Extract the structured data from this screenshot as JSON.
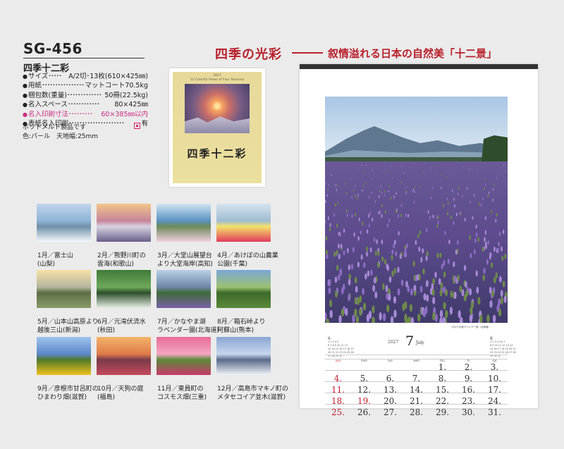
{
  "product": {
    "code": "SG-456",
    "name": "四季十二彩",
    "specs": [
      {
        "key": "サイズ",
        "dots": "･････",
        "value": "A/2切･13枚(610×425㎜)",
        "highlight": false
      },
      {
        "key": "用紙",
        "dots": "････････････････････",
        "value": "マットコート70.5kg",
        "highlight": false
      },
      {
        "key": "梱包数(重量)",
        "dots": "･････････････",
        "value": "50冊(22.5kg)",
        "highlight": false
      },
      {
        "key": "名入スペース",
        "dots": "････････････",
        "value": "80×425㎜",
        "highlight": false
      },
      {
        "key": "名入印刷寸法",
        "dots": "･････････",
        "value": "60×385㎜以内",
        "highlight": true
      },
      {
        "key": "表紙名入印刷",
        "dots": "･････････････････････",
        "value": "有",
        "highlight": false
      }
    ],
    "notes": [
      "ホットメルト製品です",
      "色:パール　天地幅:25mm"
    ]
  },
  "heading": {
    "main": "四季の光彩",
    "sub": "叙情溢れる日本の自然美「十二景」"
  },
  "cover": {
    "title": "四季十二彩",
    "subtitle": "12 Colorful Views of Four Seasons",
    "year_label": "2027"
  },
  "months": [
    {
      "caption1": "1月／富士山",
      "caption2": "(山梨)",
      "palette": [
        "#bfd5ec",
        "#8fb3d6",
        "#f4f7fb",
        "#6f8fa8"
      ]
    },
    {
      "caption1": "2月／熊野川町の",
      "caption2": "雲海(和歌山)",
      "palette": [
        "#f2c58a",
        "#c7849a",
        "#6a5f8a",
        "#d8d3e0"
      ]
    },
    {
      "caption1": "3月／大堂山展望台",
      "caption2": "より大堂海岸(高知)",
      "palette": [
        "#cfe3f2",
        "#5a92c0",
        "#f2cfe0",
        "#6e8a5a"
      ]
    },
    {
      "caption1": "4月／あけぼの山農業",
      "caption2": "公園(千葉)",
      "palette": [
        "#d5e3ee",
        "#9fbcd2",
        "#e23b5b",
        "#f3e26a"
      ]
    },
    {
      "caption1": "5月／山本山高原より",
      "caption2": "越後三山(新潟)",
      "palette": [
        "#f6e1a6",
        "#b4b5a0",
        "#8a9b6a",
        "#5c6e44"
      ]
    },
    {
      "caption1": "6月／元滝伏流水",
      "caption2": "(秋田)",
      "palette": [
        "#3f7a3a",
        "#6ea95a",
        "#e7efe5",
        "#2d4f2a"
      ]
    },
    {
      "caption1": "7月／かなやま湖",
      "caption2": "ラベンダー園(北海道)",
      "palette": [
        "#b9d0e6",
        "#6f86a8",
        "#7b62a8",
        "#3f6b3a"
      ]
    },
    {
      "caption1": "8月／箱石峠より",
      "caption2": "阿蘇山(熊本)",
      "palette": [
        "#7aa6d8",
        "#9cc070",
        "#5a8a3a",
        "#3d6a2a"
      ]
    },
    {
      "caption1": "9月／彦根市甘呂町の",
      "caption2": "ひまわり畑(滋賀)",
      "palette": [
        "#9ec4ee",
        "#5c86c8",
        "#f1c21f",
        "#4f7a2a"
      ]
    },
    {
      "caption1": "10月／天狗の庭",
      "caption2": "(福島)",
      "palette": [
        "#f3b36a",
        "#e07b4a",
        "#c44a5a",
        "#7a3a4a"
      ]
    },
    {
      "caption1": "11月／東員町の",
      "caption2": "コスモス畑(三重)",
      "palette": [
        "#e86c98",
        "#f4a6c2",
        "#c83a6a",
        "#5a8a3a"
      ]
    },
    {
      "caption1": "12月／高島市マキノ町の",
      "caption2": "メタセコイア並木(滋賀)",
      "palette": [
        "#8aa6d2",
        "#c6d6ee",
        "#f1f4f8",
        "#5a6a8a"
      ]
    }
  ],
  "calendar": {
    "year": "2027",
    "month_number": "7",
    "month_english": "July",
    "photo_caption": "かなやま湖ラベンダー園（北海道）",
    "weekdays": [
      "sun",
      "mon",
      "tue",
      "wed",
      "thu",
      "fri",
      "sat"
    ],
    "weeks": [
      [
        "",
        "",
        "",
        "",
        "1.",
        "2.",
        "3."
      ],
      [
        "4.",
        "5.",
        "6.",
        "7.",
        "8.",
        "9.",
        "10."
      ],
      [
        "11.",
        "12.",
        "13.",
        "14.",
        "15.",
        "16.",
        "17."
      ],
      [
        "18.",
        "19.",
        "20.",
        "21.",
        "22.",
        "23.",
        "24."
      ],
      [
        "25.",
        "26.",
        "27.",
        "28.",
        "29.",
        "30.",
        "31."
      ]
    ],
    "holidays": [
      "19."
    ],
    "prev_month": {
      "label": "6",
      "rows": [
        "1 2 3 4 5",
        "6 7 8 9 10 11 12",
        "13 14 15 16 17 18 19",
        "20 21 22 23 24 25 26",
        "27 28 29 30"
      ]
    },
    "next_month": {
      "label": "8",
      "rows": [
        "1 2 3 4 5 6 7",
        "8 9 10 11 12 13 14",
        "15 16 17 18 19 20 21",
        "22 23 24 25 26 27 28",
        "29 30 31"
      ]
    }
  }
}
